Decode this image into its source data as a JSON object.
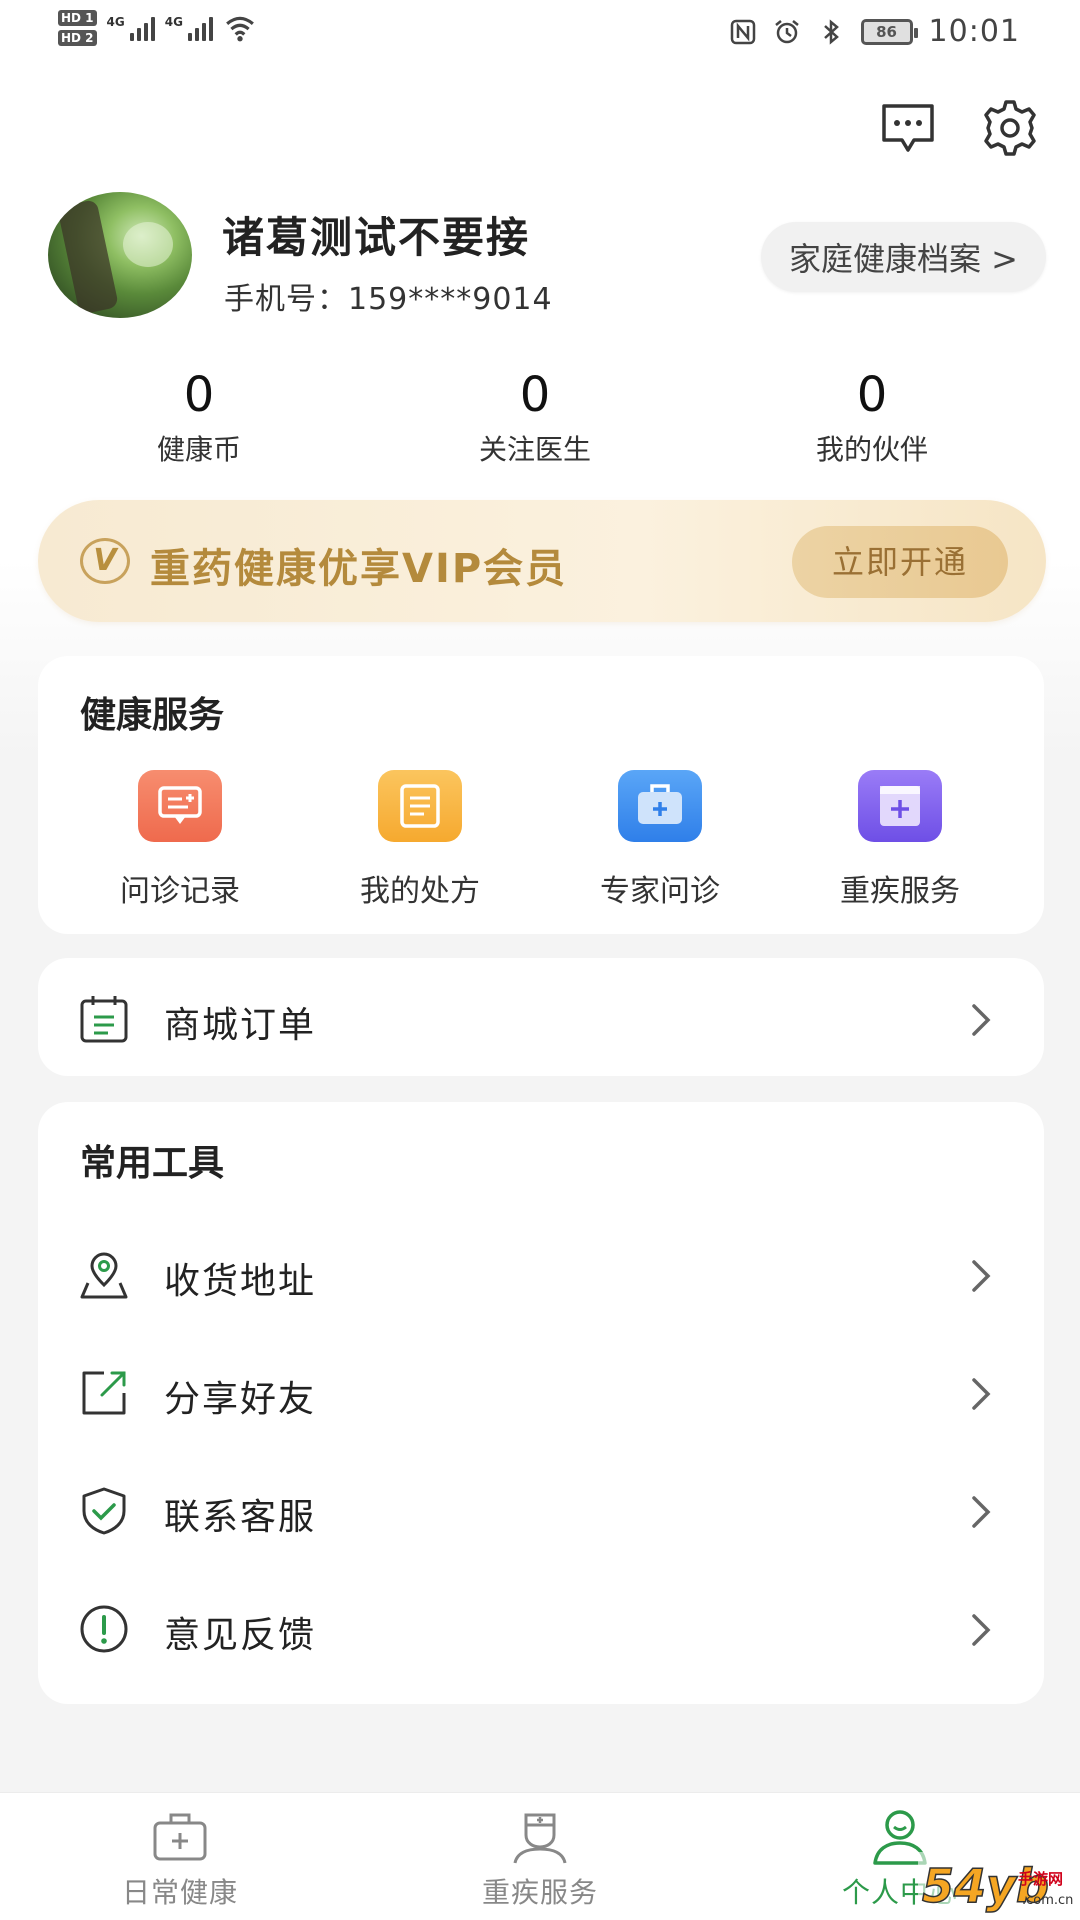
{
  "status_bar": {
    "hd1": "HD 1",
    "hd2": "HD 2",
    "net1": "4G",
    "net2": "4G",
    "battery": "86",
    "time": "10:01"
  },
  "header": {
    "message_icon": "message-icon",
    "settings_icon": "gear-icon"
  },
  "profile": {
    "name": "诸葛测试不要接",
    "phone": "手机号：159****9014",
    "family_button": "家庭健康档案 >"
  },
  "stats": [
    {
      "value": "0",
      "label": "健康币"
    },
    {
      "value": "0",
      "label": "关注医生"
    },
    {
      "value": "0",
      "label": "我的伙伴"
    }
  ],
  "vip": {
    "badge": "V",
    "title": "重药健康优享VIP会员",
    "button": "立即开通"
  },
  "health_services": {
    "title": "健康服务",
    "items": [
      {
        "label": "问诊记录",
        "icon": "consult-record-icon",
        "color": "#f27a5c"
      },
      {
        "label": "我的处方",
        "icon": "prescription-icon",
        "color": "#f9b441"
      },
      {
        "label": "专家问诊",
        "icon": "medical-kit-icon",
        "color": "#3d8ef0"
      },
      {
        "label": "重疾服务",
        "icon": "critical-care-icon",
        "color": "#7b5cf0"
      }
    ]
  },
  "orders": {
    "label": "商城订单",
    "icon": "calendar-order-icon"
  },
  "tools": {
    "title": "常用工具",
    "items": [
      {
        "label": "收货地址",
        "icon": "location-icon"
      },
      {
        "label": "分享好友",
        "icon": "share-icon"
      },
      {
        "label": "联系客服",
        "icon": "shield-check-icon"
      },
      {
        "label": "意见反馈",
        "icon": "feedback-icon"
      }
    ]
  },
  "tabbar": {
    "tabs": [
      {
        "label": "日常健康",
        "icon": "medical-bag-icon"
      },
      {
        "label": "重疾服务",
        "icon": "doctor-icon"
      },
      {
        "label": "个人中心",
        "icon": "person-icon",
        "active": true
      }
    ],
    "active_color": "#2c9a4a"
  },
  "watermark": "54yb手游网"
}
